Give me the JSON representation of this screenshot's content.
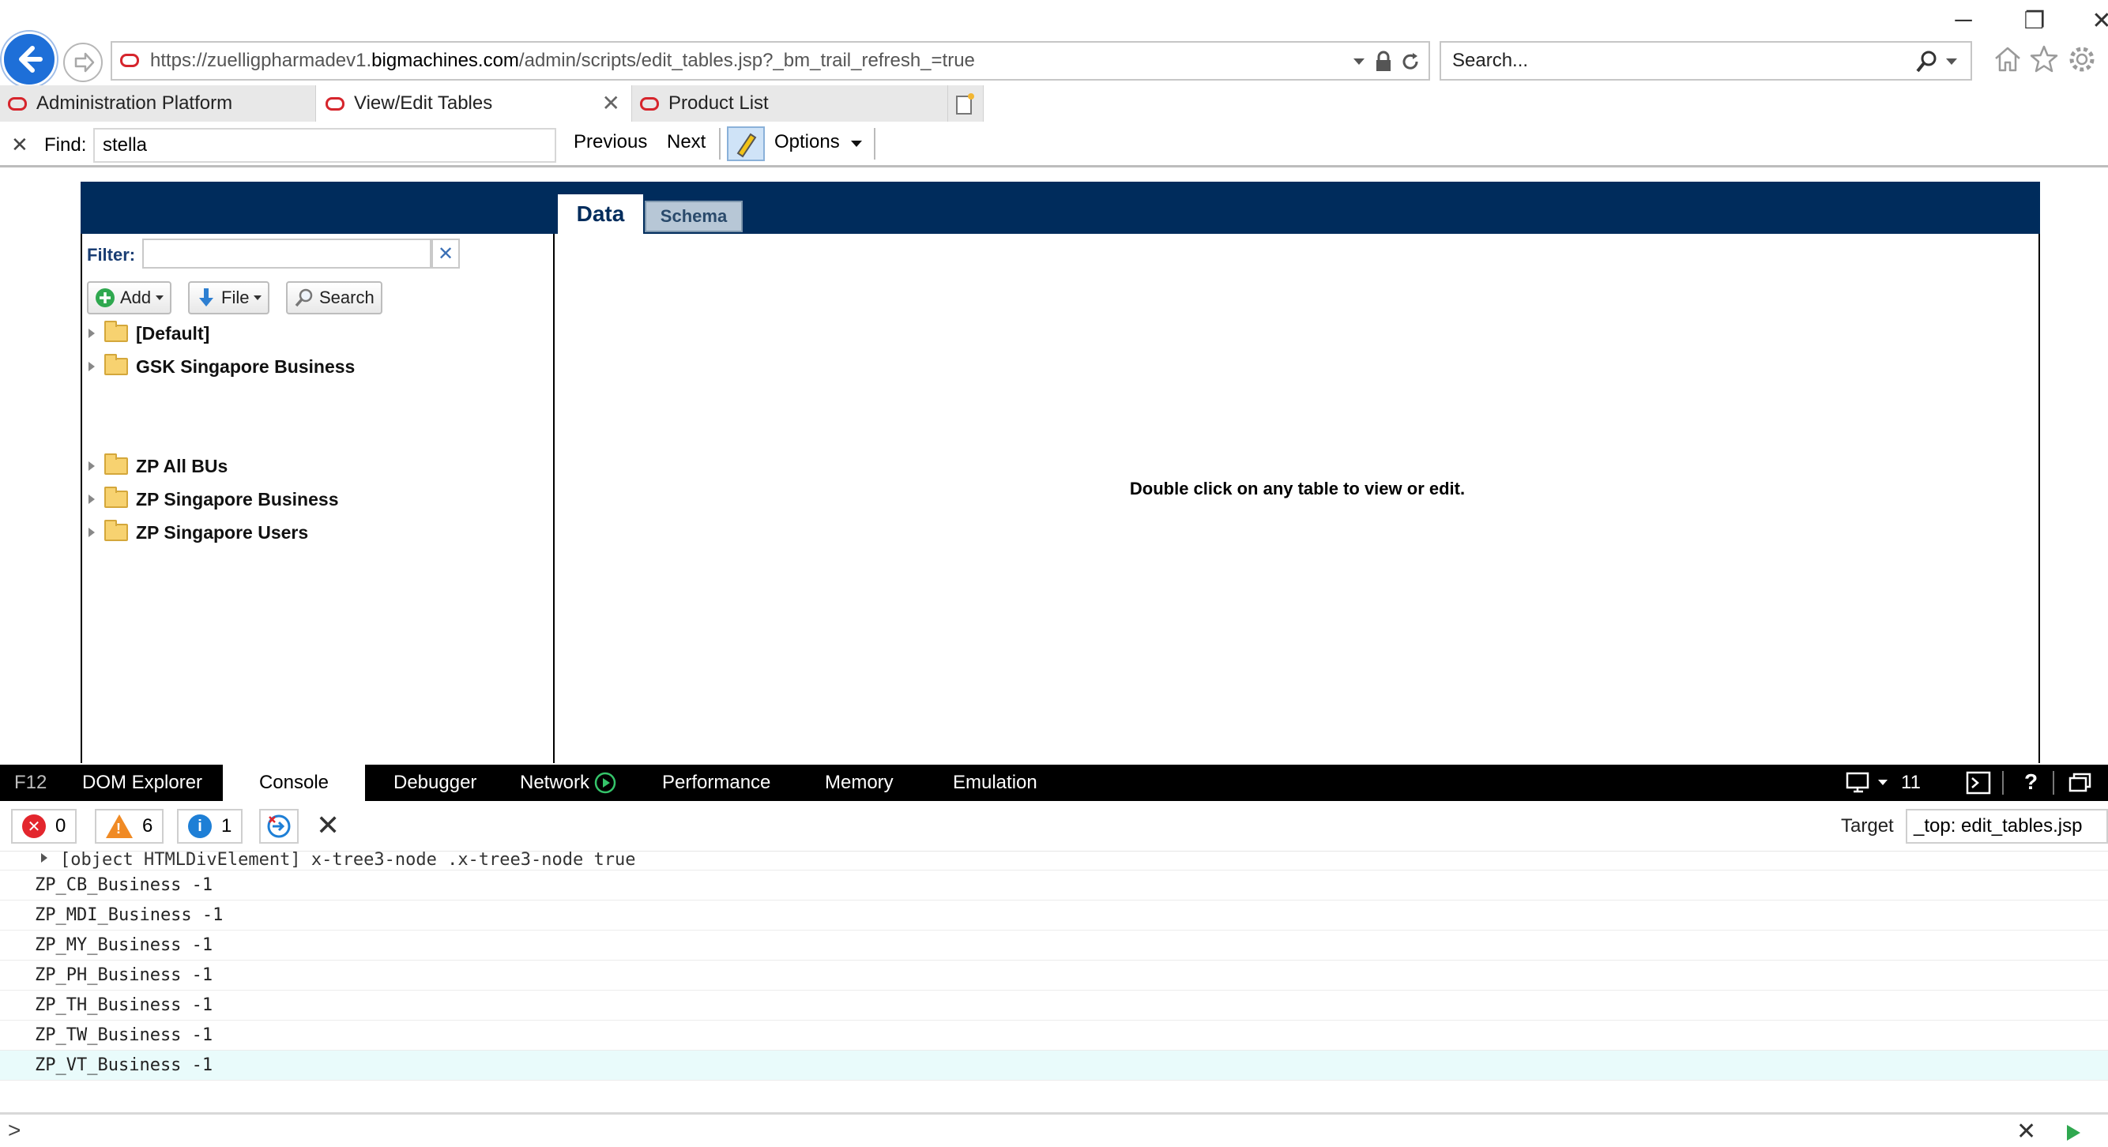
{
  "window": {
    "minimize": "─",
    "maximize": "❐",
    "close": "✕"
  },
  "browser": {
    "url_prefix": "https://zuelligpharmadev1.",
    "url_domain": "bigmachines.com",
    "url_path": "/admin/scripts/edit_tables.jsp?_bm_trail_refresh_=true",
    "search_placeholder": "Search...",
    "tabs": [
      {
        "label": "Administration Platform",
        "active": false
      },
      {
        "label": "View/Edit Tables",
        "active": true
      },
      {
        "label": "Product List",
        "active": false
      }
    ]
  },
  "findbar": {
    "label": "Find:",
    "value": "stella",
    "previous": "Previous",
    "next": "Next",
    "options": "Options"
  },
  "app": {
    "tabs": {
      "data": "Data",
      "schema": "Schema"
    },
    "filter_label": "Filter:",
    "buttons": {
      "add": "Add",
      "file": "File",
      "search": "Search"
    },
    "tree": [
      {
        "label": "[Default]"
      },
      {
        "label": "GSK Singapore Business"
      },
      {
        "label": "ZP All BUs"
      },
      {
        "label": "ZP Singapore Business"
      },
      {
        "label": "ZP Singapore Users"
      }
    ],
    "empty_message": "Double click on any table to view or edit."
  },
  "devtools": {
    "tabs": [
      "F12",
      "DOM Explorer",
      "Console",
      "Debugger",
      "Network",
      "Performance",
      "Memory",
      "Emulation"
    ],
    "active_tab": "Console",
    "doc_mode": "11",
    "counts": {
      "errors": "0",
      "warnings": "6",
      "info": "1"
    },
    "target_label": "Target",
    "target_value": "_top: edit_tables.jsp",
    "log_first": "[object HTMLDivElement] x-tree3-node .x-tree3-node true",
    "log_lines": [
      "ZP_CB_Business -1",
      "ZP_MDI_Business -1",
      "ZP_MY_Business -1",
      "ZP_PH_Business -1",
      "ZP_TH_Business -1",
      "ZP_TW_Business -1",
      "ZP_VT_Business -1"
    ],
    "prompt": ">"
  },
  "colors": {
    "app_header": "#002c5c",
    "brand_red": "#d6252c",
    "back_blue": "#1e6fd8",
    "devtools_bar": "#000000"
  }
}
